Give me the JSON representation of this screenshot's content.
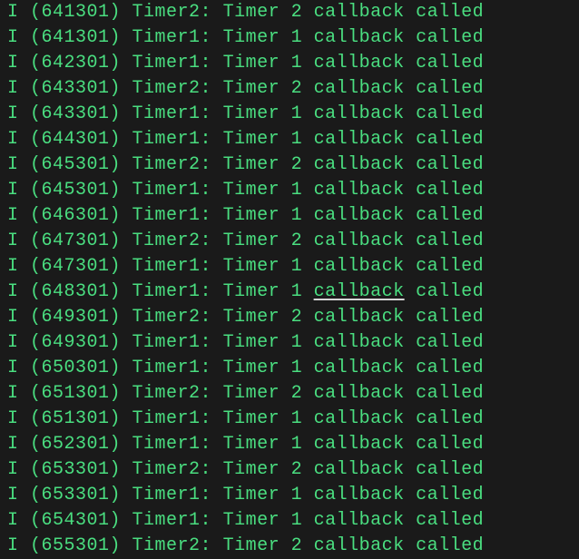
{
  "colors": {
    "background": "#1a1a1a",
    "text": "#4ade80"
  },
  "logs": [
    {
      "level": "I",
      "timestamp": "641301",
      "tag": "Timer2",
      "message": "Timer 2 callback called"
    },
    {
      "level": "I",
      "timestamp": "641301",
      "tag": "Timer1",
      "message": "Timer 1 callback called"
    },
    {
      "level": "I",
      "timestamp": "642301",
      "tag": "Timer1",
      "message": "Timer 1 callback called"
    },
    {
      "level": "I",
      "timestamp": "643301",
      "tag": "Timer2",
      "message": "Timer 2 callback called"
    },
    {
      "level": "I",
      "timestamp": "643301",
      "tag": "Timer1",
      "message": "Timer 1 callback called"
    },
    {
      "level": "I",
      "timestamp": "644301",
      "tag": "Timer1",
      "message": "Timer 1 callback called"
    },
    {
      "level": "I",
      "timestamp": "645301",
      "tag": "Timer2",
      "message": "Timer 2 callback called"
    },
    {
      "level": "I",
      "timestamp": "645301",
      "tag": "Timer1",
      "message": "Timer 1 callback called"
    },
    {
      "level": "I",
      "timestamp": "646301",
      "tag": "Timer1",
      "message": "Timer 1 callback called"
    },
    {
      "level": "I",
      "timestamp": "647301",
      "tag": "Timer2",
      "message": "Timer 2 callback called"
    },
    {
      "level": "I",
      "timestamp": "647301",
      "tag": "Timer1",
      "message": "Timer 1 callback called"
    },
    {
      "level": "I",
      "timestamp": "648301",
      "tag": "Timer1",
      "message": "Timer 1 callback called",
      "underline_word": "callback"
    },
    {
      "level": "I",
      "timestamp": "649301",
      "tag": "Timer2",
      "message": "Timer 2 callback called"
    },
    {
      "level": "I",
      "timestamp": "649301",
      "tag": "Timer1",
      "message": "Timer 1 callback called"
    },
    {
      "level": "I",
      "timestamp": "650301",
      "tag": "Timer1",
      "message": "Timer 1 callback called"
    },
    {
      "level": "I",
      "timestamp": "651301",
      "tag": "Timer2",
      "message": "Timer 2 callback called"
    },
    {
      "level": "I",
      "timestamp": "651301",
      "tag": "Timer1",
      "message": "Timer 1 callback called"
    },
    {
      "level": "I",
      "timestamp": "652301",
      "tag": "Timer1",
      "message": "Timer 1 callback called"
    },
    {
      "level": "I",
      "timestamp": "653301",
      "tag": "Timer2",
      "message": "Timer 2 callback called"
    },
    {
      "level": "I",
      "timestamp": "653301",
      "tag": "Timer1",
      "message": "Timer 1 callback called"
    },
    {
      "level": "I",
      "timestamp": "654301",
      "tag": "Timer1",
      "message": "Timer 1 callback called"
    },
    {
      "level": "I",
      "timestamp": "655301",
      "tag": "Timer2",
      "message": "Timer 2 callback called"
    }
  ]
}
